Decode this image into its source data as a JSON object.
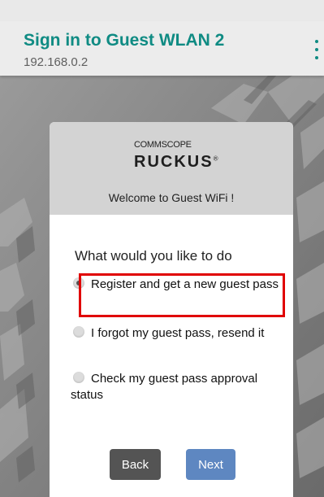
{
  "app_bar": {
    "title": "Sign in to Guest WLAN 2",
    "url": "192.168.0.2",
    "menu_icon": "more-vert-icon"
  },
  "header": {
    "brand_top": "COMMSCOPE",
    "brand_main": "RUCKUS",
    "registered_mark": "®",
    "welcome": "Welcome to Guest WiFi !"
  },
  "form": {
    "question": "What would you like to do",
    "options": [
      {
        "label": "Register and get a new guest pass",
        "selected": true
      },
      {
        "label": "I forgot my guest pass, resend it",
        "selected": false
      },
      {
        "label": "Check my guest pass approval status",
        "selected": false
      }
    ]
  },
  "buttons": {
    "back": "Back",
    "next": "Next"
  },
  "colors": {
    "title": "#0f8b83",
    "back_button": "#545454",
    "next_button": "#5e87c1",
    "highlight": "#e00000",
    "background": "#7e7e7e"
  }
}
